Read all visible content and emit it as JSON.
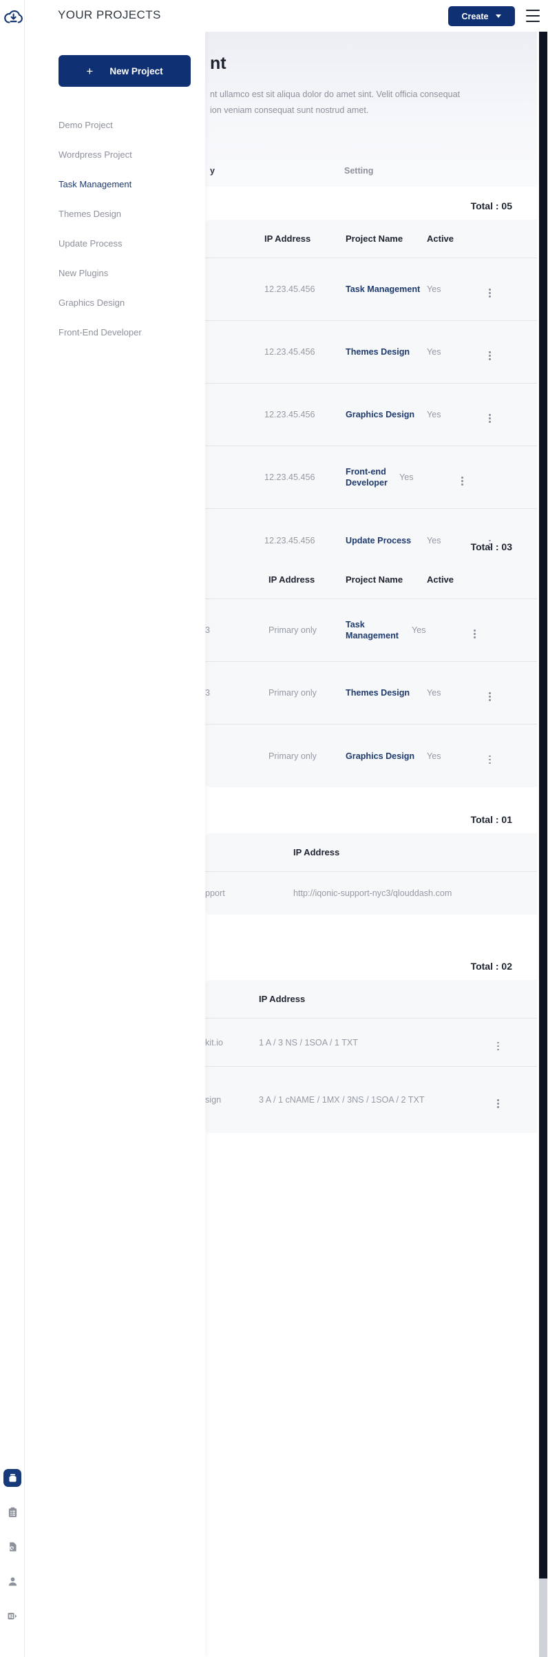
{
  "app": {
    "logo_icon": "cloud-download-icon",
    "header_title": "YOUR PROJECTS",
    "create_button": "Create",
    "create_caret_icon": "chevron-down-icon",
    "menu_icon": "hamburger-menu-icon",
    "accent_color": "#0F3072",
    "link_color": "#1e3a6e",
    "muted_color": "#9499a3",
    "card_bg": "#f7f8fa"
  },
  "rail": {
    "items": [
      {
        "icon": "database-icon",
        "active": true
      },
      {
        "icon": "clipboard-list-icon",
        "active": false
      },
      {
        "icon": "file-search-icon",
        "active": false
      },
      {
        "icon": "user-icon",
        "active": false
      },
      {
        "icon": "server-icon",
        "active": false
      }
    ]
  },
  "panel": {
    "new_project_button": "New Project",
    "plus_icon": "plus-icon",
    "items": [
      {
        "label": "Demo Project",
        "active": false
      },
      {
        "label": "Wordpress Project",
        "active": false
      },
      {
        "label": "Task Management",
        "active": true
      },
      {
        "label": "Themes Design",
        "active": false
      },
      {
        "label": "Update Process",
        "active": false
      },
      {
        "label": "New Plugins",
        "active": false
      },
      {
        "label": "Graphics Design",
        "active": false
      },
      {
        "label": "Front-End Developer",
        "active": false
      }
    ]
  },
  "hero": {
    "title_visible": "nt",
    "description": "nt ullamco est sit aliqua dolor do amet sint. Velit officia consequat\nion veniam consequat sunt nostrud amet.",
    "tab_partial": "y",
    "tab_setting": "Setting"
  },
  "sections": [
    {
      "total_label": "Total : 05",
      "columns": [
        "IP Address",
        "Project Name",
        "Active"
      ],
      "rows": [
        {
          "left": "",
          "ip": "12.23.45.456",
          "name": "Task Management",
          "active": "Yes",
          "menu": "kebab-menu-icon"
        },
        {
          "left": "",
          "ip": "12.23.45.456",
          "name": "Themes Design",
          "active": "Yes",
          "menu": "kebab-menu-icon"
        },
        {
          "left": "",
          "ip": "12.23.45.456",
          "name": "Graphics Design",
          "active": "Yes",
          "menu": "kebab-menu-icon"
        },
        {
          "left": "",
          "ip": "12.23.45.456",
          "name": "Front-end Developer",
          "active": "Yes",
          "menu": "kebab-menu-icon"
        },
        {
          "left": "",
          "ip": "12.23.45.456",
          "name": "Update Process",
          "active": "Yes",
          "menu": "kebab-menu-icon"
        }
      ]
    },
    {
      "total_label": "Total : 03",
      "columns": [
        "IP Address",
        "Project Name",
        "Active"
      ],
      "rows": [
        {
          "left": "3",
          "ip": "Primary only",
          "name": "Task Management",
          "active": "Yes",
          "menu": "kebab-menu-icon"
        },
        {
          "left": "3",
          "ip": "Primary only",
          "name": "Themes Design",
          "active": "Yes",
          "menu": "kebab-menu-icon"
        },
        {
          "left": "",
          "ip": "Primary only",
          "name": "Graphics Design",
          "active": "Yes",
          "menu": "kebab-menu-icon"
        }
      ]
    },
    {
      "total_label": "Total : 01",
      "columns": [
        "IP Address"
      ],
      "rows": [
        {
          "left": "pport",
          "ip": "http://iqonic-support-nyc3/qlouddash.com",
          "name": "",
          "active": "",
          "menu": ""
        }
      ]
    },
    {
      "total_label": "Total : 02",
      "columns": [
        "IP Address"
      ],
      "rows": [
        {
          "left": "kit.io",
          "ip": "1 A / 3 NS / 1SOA / 1 TXT",
          "name": "",
          "active": "",
          "menu": "kebab-menu-icon"
        },
        {
          "left": "sign",
          "ip": "3 A / 1 cNAME / 1MX / 3NS / 1SOA / 2 TXT",
          "name": "",
          "active": "",
          "menu": "kebab-menu-icon"
        }
      ]
    }
  ]
}
